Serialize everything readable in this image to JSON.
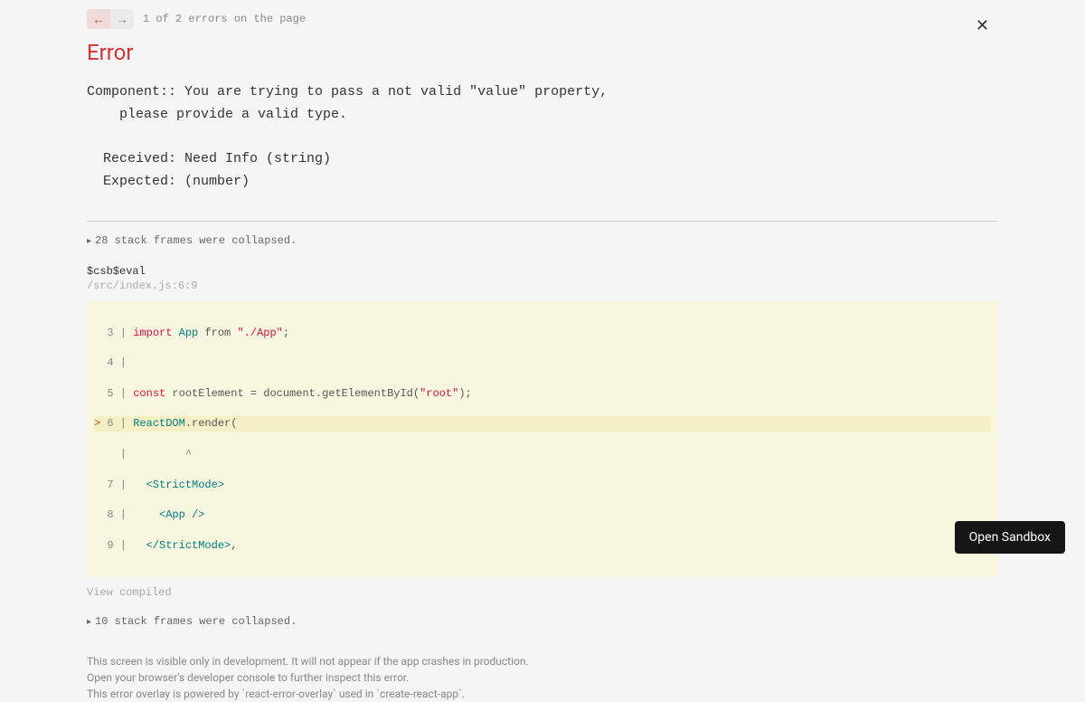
{
  "nav": {
    "error_count_text": "1 of 2 errors on the page"
  },
  "error": {
    "title": "Error",
    "message": "Component:: You are trying to pass a not valid \"value\" property,\n    please provide a valid type.\n\n  Received: Need Info (string)\n  Expected: (number)"
  },
  "stack": {
    "collapse1": "28 stack frames were collapsed.",
    "frame_name": "$csb$eval",
    "frame_location": "/src/index.js:6:9",
    "collapse2": "10 stack frames were collapsed.",
    "view_compiled": "View compiled"
  },
  "code": {
    "line3_num": "  3 | ",
    "line3_import": "import",
    "line3_app": " App",
    "line3_from": " from ",
    "line3_str": "\"./App\"",
    "line3_semi": ";",
    "line4": "  4 | ",
    "line5_num": "  5 | ",
    "line5_const": "const",
    "line5_mid": " rootElement = document.getElementById(",
    "line5_str": "\"root\"",
    "line5_end": ");",
    "line6_mark": "> ",
    "line6_num": "6 | ",
    "line6_reactdom": "ReactDOM",
    "line6_render": ".render(",
    "line_caret": "    |         ^",
    "line7_num": "  7 |   ",
    "line7_tag": "<StrictMode>",
    "line8_num": "  8 |     ",
    "line8_tag": "<App />",
    "line9_num": "  9 |   ",
    "line9_tag": "</StrictMode>",
    "line9_comma": ","
  },
  "footer": {
    "line1": "This screen is visible only in development. It will not appear if the app crashes in production.",
    "line2": "Open your browser's developer console to further inspect this error.",
    "line3": "This error overlay is powered by `react-error-overlay` used in `create-react-app`."
  },
  "sandbox_button": "Open Sandbox"
}
